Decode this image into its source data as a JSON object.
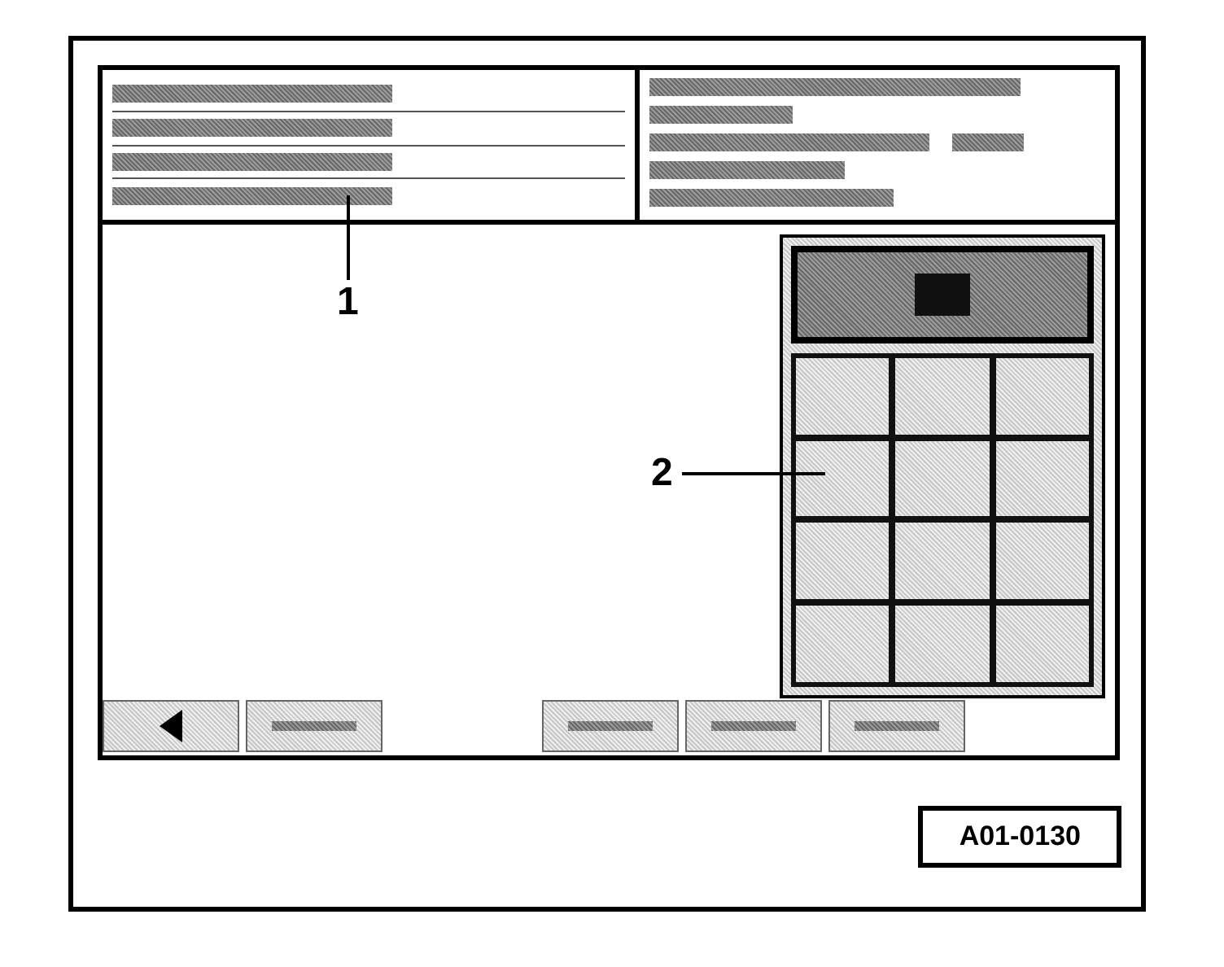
{
  "screen": {
    "header_left": [
      {
        "kind": "blurred_text"
      },
      {
        "kind": "blurred_text"
      },
      {
        "kind": "blurred_text"
      },
      {
        "kind": "blurred_text"
      }
    ],
    "header_right": [
      {
        "kind": "blurred_text"
      },
      {
        "kind": "blurred_text"
      },
      {
        "kind": "blurred_pair"
      },
      {
        "kind": "blurred_text"
      },
      {
        "kind": "blurred_text"
      }
    ],
    "keypad": {
      "display": {
        "kind": "dark_block"
      },
      "keys": [
        {
          "kind": "blank"
        },
        {
          "kind": "blank"
        },
        {
          "kind": "blank"
        },
        {
          "kind": "blank"
        },
        {
          "kind": "blank"
        },
        {
          "kind": "blank"
        },
        {
          "kind": "blank"
        },
        {
          "kind": "blank"
        },
        {
          "kind": "blank"
        },
        {
          "kind": "blank"
        },
        {
          "kind": "blank"
        },
        {
          "kind": "blank"
        }
      ]
    },
    "button_groups": [
      [
        {
          "kind": "back_arrow"
        },
        {
          "kind": "blurred_label"
        }
      ],
      [
        {
          "kind": "blurred_label"
        },
        {
          "kind": "blurred_label"
        },
        {
          "kind": "blurred_label"
        }
      ]
    ]
  },
  "callouts": [
    {
      "label": "1",
      "kind": "vertical"
    },
    {
      "label": "2",
      "kind": "horizontal"
    }
  ],
  "figure_code": "A01-0130"
}
